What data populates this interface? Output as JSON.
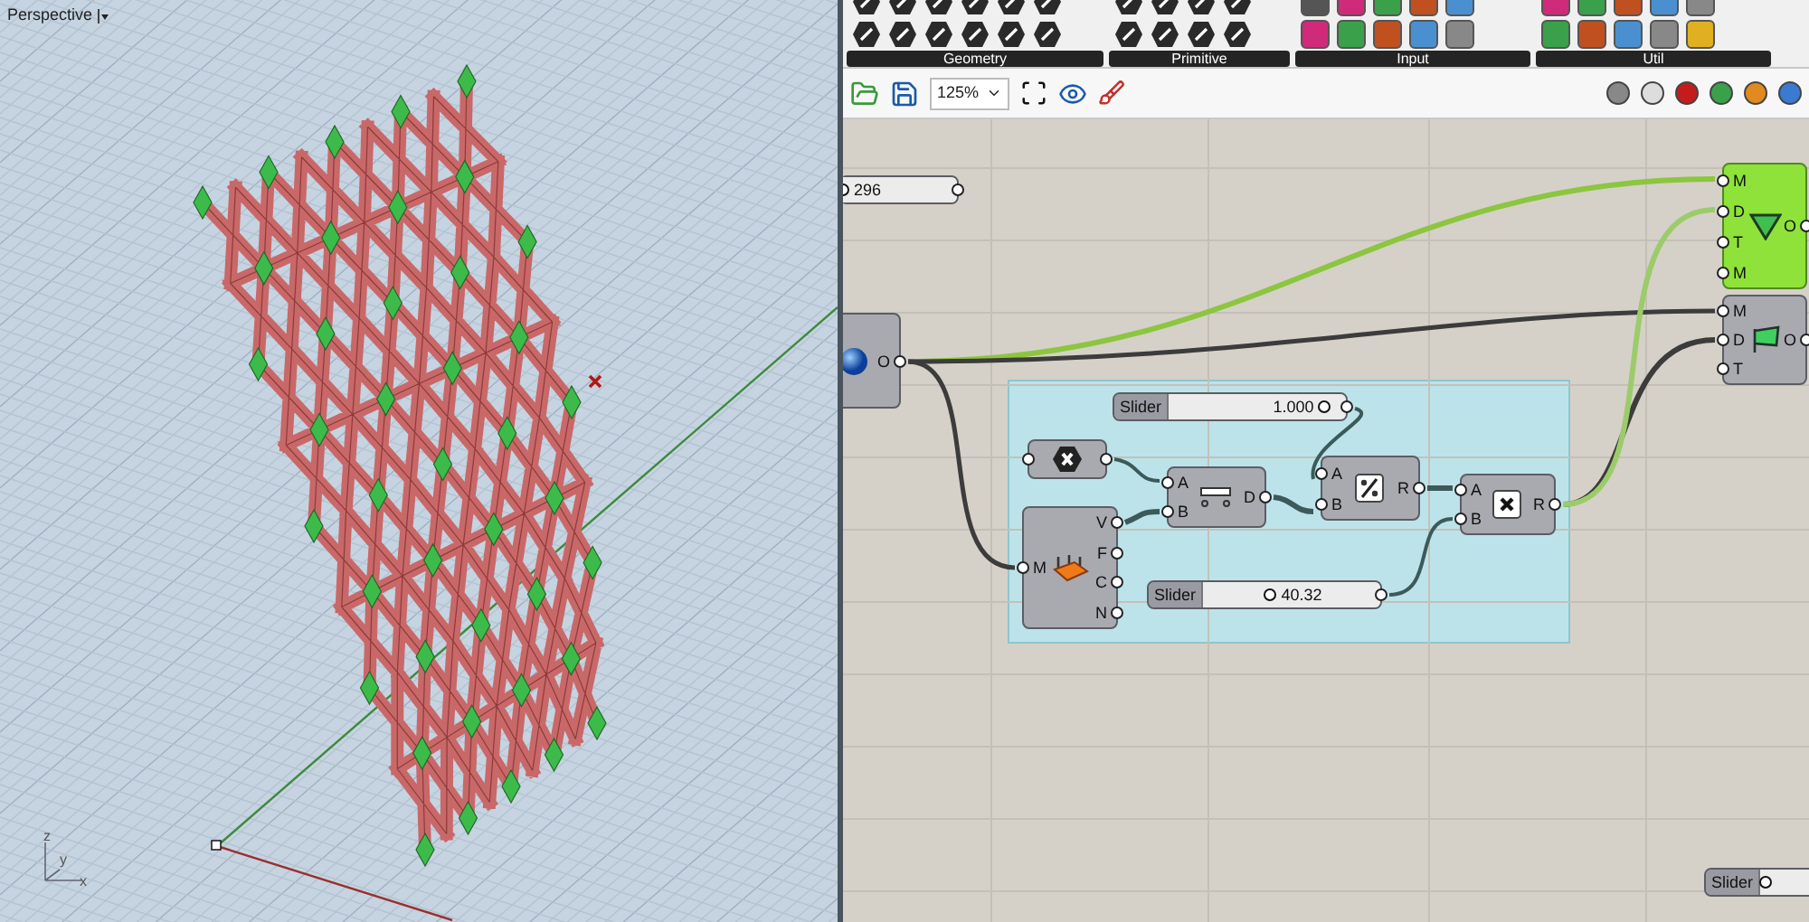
{
  "viewport": {
    "title": "Perspective",
    "axis_labels": [
      "z",
      "y",
      "x"
    ]
  },
  "ribbon": {
    "groups": [
      {
        "label": "Geometry"
      },
      {
        "label": "Primitive"
      },
      {
        "label": "Input"
      },
      {
        "label": "Util"
      }
    ]
  },
  "toolbar": {
    "zoom": "125%"
  },
  "canvas": {
    "nodes": [
      {
        "kind": "slider",
        "value": "296",
        "level": 0
      },
      {
        "kind": "component",
        "outputs": [
          "O"
        ],
        "selected": false
      },
      {
        "kind": "component",
        "inputs": [
          "M",
          "D",
          "T",
          "M"
        ],
        "outputs": [
          "O"
        ],
        "selected": true
      },
      {
        "kind": "component",
        "inputs": [
          "M",
          "D",
          "T"
        ],
        "outputs": [
          "O"
        ],
        "selected": false
      },
      {
        "kind": "slider",
        "label": "Slider",
        "value": "1.000",
        "level": 0.88
      },
      {
        "kind": "component",
        "selected": false
      },
      {
        "kind": "component",
        "inputs": [
          "A",
          "B"
        ],
        "outputs": [
          "D"
        ],
        "selected": false
      },
      {
        "kind": "component",
        "inputs": [
          "A",
          "B"
        ],
        "outputs": [
          "R"
        ],
        "selected": false
      },
      {
        "kind": "component",
        "inputs": [
          "A",
          "B"
        ],
        "outputs": [
          "R"
        ],
        "selected": false
      },
      {
        "kind": "component",
        "inputs": [
          "M"
        ],
        "outputs": [
          "V",
          "F",
          "C",
          "N"
        ],
        "selected": false
      },
      {
        "kind": "slider",
        "label": "Slider",
        "value": "40.32",
        "level": 0.38
      },
      {
        "kind": "slider",
        "label": "Slider",
        "level": 0.08
      }
    ]
  }
}
